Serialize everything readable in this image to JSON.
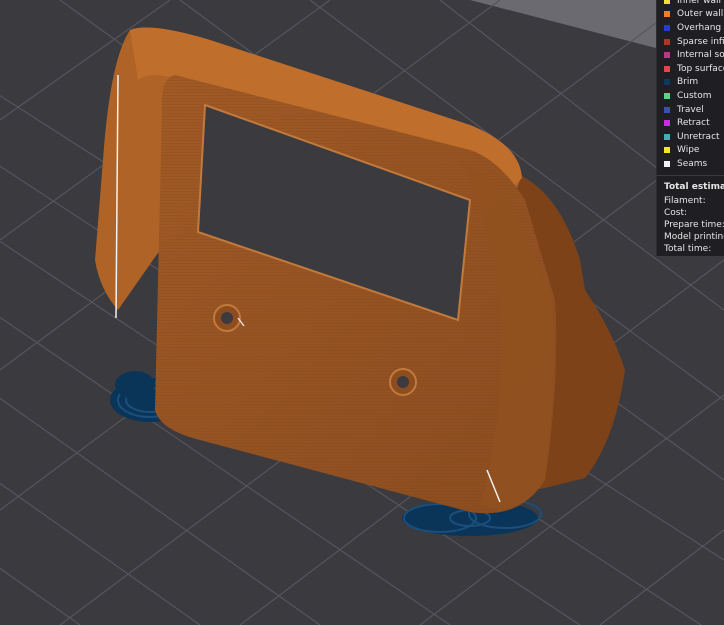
{
  "legend": {
    "items": [
      {
        "label": "Inner wall",
        "color": "#f0e03c"
      },
      {
        "label": "Outer wall",
        "color": "#f07f2d"
      },
      {
        "label": "Overhang wall",
        "color": "#2a39d6"
      },
      {
        "label": "Sparse infill",
        "color": "#a33b2a"
      },
      {
        "label": "Internal solid infill",
        "color": "#b43a85"
      },
      {
        "label": "Top surface",
        "color": "#e0464a"
      },
      {
        "label": "Brim",
        "color": "#0a3a5c"
      },
      {
        "label": "Custom",
        "color": "#5fd08a"
      },
      {
        "label": "Travel",
        "color": "#3b4fb0"
      },
      {
        "label": "Retract",
        "color": "#d12ad6"
      },
      {
        "label": "Unretract",
        "color": "#3fb0b8"
      },
      {
        "label": "Wipe",
        "color": "#f3ea1c"
      },
      {
        "label": "Seams",
        "color": "#f2f2f2"
      }
    ]
  },
  "estimation": {
    "title": "Total estimation",
    "rows": [
      "Filament:",
      "Cost:",
      "Prepare time:",
      "Model printing time:",
      "Total time:"
    ]
  }
}
